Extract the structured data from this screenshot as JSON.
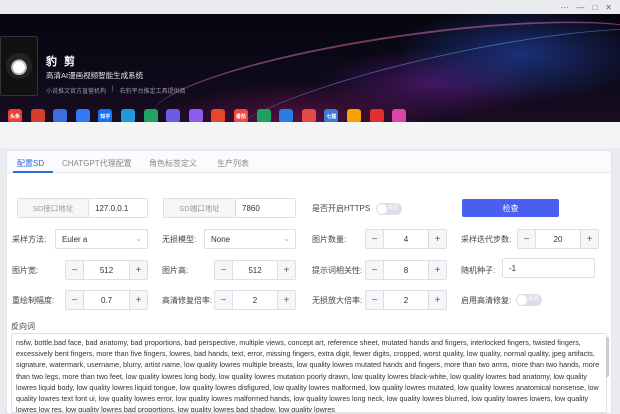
{
  "window": {
    "controls": [
      "⋯",
      "—",
      "□",
      "✕"
    ]
  },
  "header": {
    "title": "豹 剪",
    "subtitle": "高清AI漫画视频智能生成系统",
    "links": [
      "小说推文官方直营机构",
      "|",
      "右豹平台推定工具提供商"
    ]
  },
  "apps": [
    {
      "label": "头条",
      "color": "#e84033"
    },
    {
      "label": "",
      "color": "#d93b2f"
    },
    {
      "label": "",
      "color": "#3b6fe0"
    },
    {
      "label": "",
      "color": "#3478f6"
    },
    {
      "label": "知乎",
      "color": "#1772f6"
    },
    {
      "label": "",
      "color": "#1e9bd7"
    },
    {
      "label": "",
      "color": "#21a366"
    },
    {
      "label": "",
      "color": "#6b5ce7"
    },
    {
      "label": "",
      "color": "#8a5cf0"
    },
    {
      "label": "",
      "color": "#e8462b"
    },
    {
      "label": "番茄",
      "color": "#f04b3c"
    },
    {
      "label": "",
      "color": "#1aa260"
    },
    {
      "label": "",
      "color": "#2c7be5"
    },
    {
      "label": "",
      "color": "#e54848"
    },
    {
      "label": "七猫",
      "color": "#3a7bd5"
    },
    {
      "label": "",
      "color": "#f5a300"
    },
    {
      "label": "",
      "color": "#e02f2f"
    },
    {
      "label": "",
      "color": "#d946a8"
    }
  ],
  "tabs": [
    "配置SD",
    "CHATGPT代理配置",
    "角色标签定义",
    "生产列表"
  ],
  "form": {
    "sd_host_label": "SD接口地址",
    "sd_host": "127.0.0.1",
    "sd_port_label": "SD端口地址",
    "sd_port": "7860",
    "https_label": "是否开启HTTPS",
    "https_toggle": "关闭",
    "check_button": "检查",
    "sampler_label": "采样方法:",
    "sampler": "Euler a",
    "lossless_label": "无损模型:",
    "lossless": "None",
    "image_count_label": "图片数量:",
    "image_count": "4",
    "sample_steps_label": "采样迭代步数:",
    "sample_steps": "20",
    "width_label": "图片宽:",
    "width": "512",
    "height_label": "图片高:",
    "height": "512",
    "cfg_label": "提示词相关性:",
    "cfg": "8",
    "seed_label": "随机种子:",
    "seed": "-1",
    "redraw_label": "重绘制幅度:",
    "redraw": "0.7",
    "hires_scale_label": "高清修复倍率:",
    "hires_scale": "2",
    "upscale_label": "无损放大倍率:",
    "upscale": "2",
    "hires_enable_label": "启用高清修复:",
    "hires_toggle": "关闭",
    "negative_label": "反向词",
    "negative_prompt": "nsfw, bottle,bad face, bad anatomy, bad proportions, bad perspective, multiple views, concept art, reference sheet, mutated hands and fingers, interlocked fingers, twisted fingers, excessively bent fingers, more than five fingers, lowres, bad hands, text, error, missing fingers, extra digit, fewer digits, cropped, worst quality, low quality, normal quality, jpeg artifacts, signature, watermark, username, blurry, artist name, low quality lowres multiple breasts, low quality lowres mutated hands and fingers, more than two arms, more than two hands, more than two legs, more than two feet, low quality lowres long body, low quality lowres mutation poorly drawn, low quality lowres black-white, low quality lowres bad anatomy, low quality lowres liquid body, low quality lowres liquid tongue, low quality lowres disfigured, low quality lowres malformed, low quality lowres mutated, low quality lowres anatomical nonsense, low quality lowres text font ui, low quality lowres error, low quality lowres malformed hands, low quality lowres long neck, low quality lowres blurred, low quality lowres lowers, low quality lowres low res, low quality lowres bad proportions, low quality lowres bad shadow, low quality lowres"
  }
}
